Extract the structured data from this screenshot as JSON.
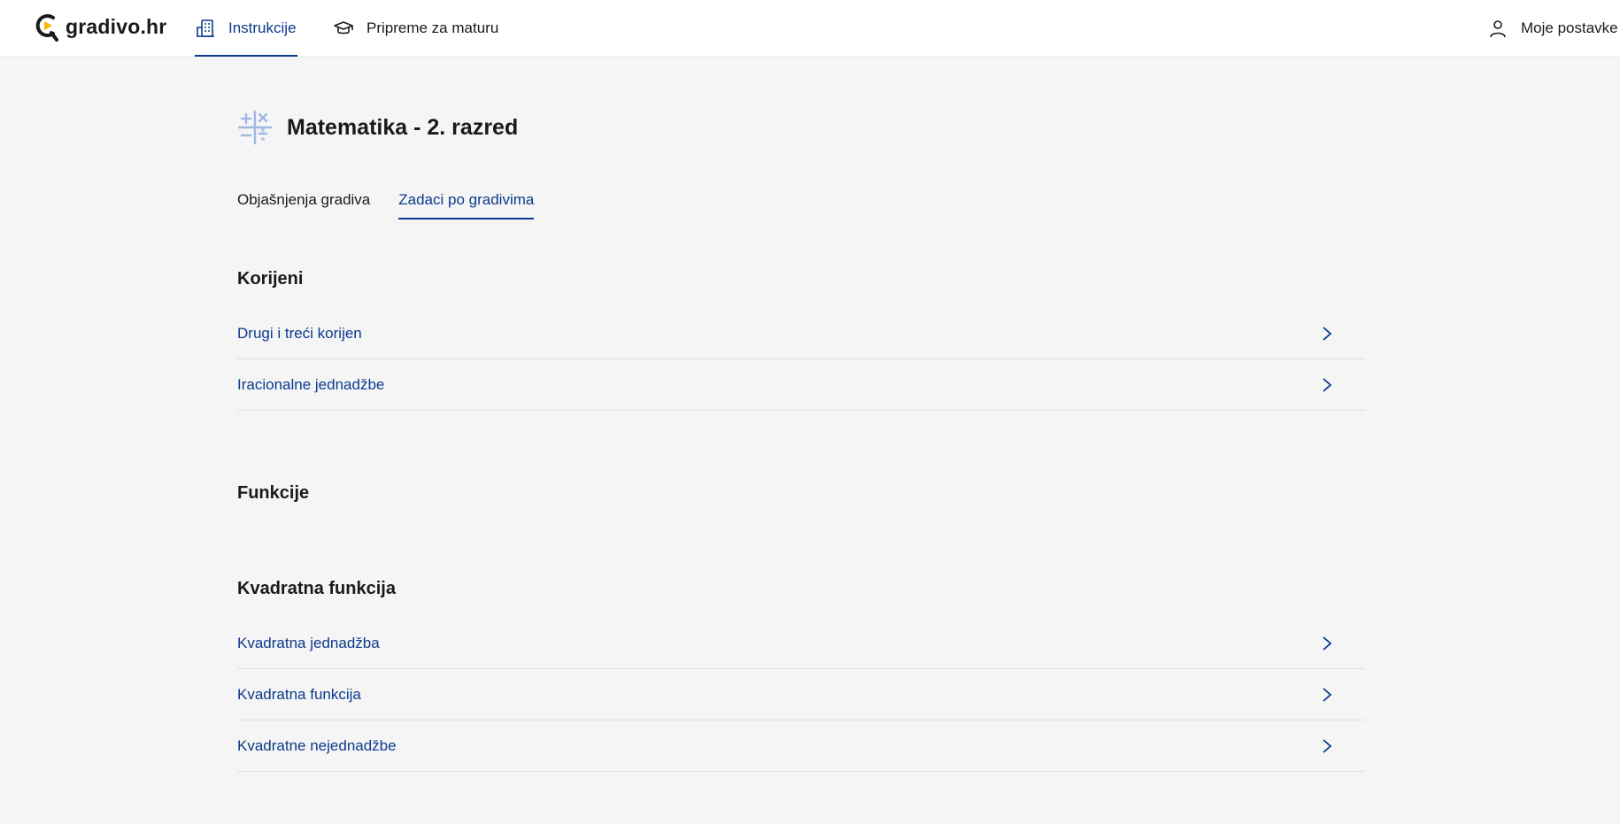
{
  "brand": {
    "name": "gradivo.hr"
  },
  "nav": {
    "instrukcije": "Instrukcije",
    "pripreme": "Pripreme za maturu",
    "settings": "Moje postavke"
  },
  "page": {
    "title": "Matematika - 2. razred"
  },
  "tabs": [
    {
      "label": "Objašnjenja gradiva"
    },
    {
      "label": "Zadaci po gradivima"
    }
  ],
  "sections": [
    {
      "title": "Korijeni",
      "items": [
        "Drugi i treći korijen",
        "Iracionalne jednadžbe"
      ]
    },
    {
      "title": "Funkcije",
      "items": []
    },
    {
      "title": "Kvadratna funkcija",
      "items": [
        "Kvadratna jednadžba",
        "Kvadratna funkcija",
        "Kvadratne nejednadžbe"
      ]
    }
  ],
  "colors": {
    "accent": "#0b3a8c",
    "logo_yellow": "#f5b800",
    "background": "#f5f5f5"
  }
}
